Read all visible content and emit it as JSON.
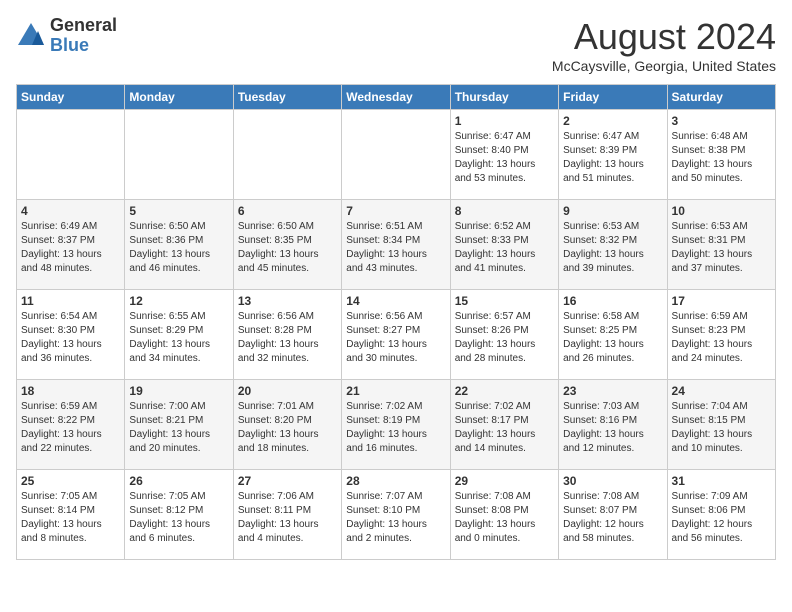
{
  "logo": {
    "general": "General",
    "blue": "Blue"
  },
  "title": "August 2024",
  "location": "McCaysville, Georgia, United States",
  "days_header": [
    "Sunday",
    "Monday",
    "Tuesday",
    "Wednesday",
    "Thursday",
    "Friday",
    "Saturday"
  ],
  "weeks": [
    [
      {
        "day": "",
        "info": ""
      },
      {
        "day": "",
        "info": ""
      },
      {
        "day": "",
        "info": ""
      },
      {
        "day": "",
        "info": ""
      },
      {
        "day": "1",
        "info": "Sunrise: 6:47 AM\nSunset: 8:40 PM\nDaylight: 13 hours\nand 53 minutes."
      },
      {
        "day": "2",
        "info": "Sunrise: 6:47 AM\nSunset: 8:39 PM\nDaylight: 13 hours\nand 51 minutes."
      },
      {
        "day": "3",
        "info": "Sunrise: 6:48 AM\nSunset: 8:38 PM\nDaylight: 13 hours\nand 50 minutes."
      }
    ],
    [
      {
        "day": "4",
        "info": "Sunrise: 6:49 AM\nSunset: 8:37 PM\nDaylight: 13 hours\nand 48 minutes."
      },
      {
        "day": "5",
        "info": "Sunrise: 6:50 AM\nSunset: 8:36 PM\nDaylight: 13 hours\nand 46 minutes."
      },
      {
        "day": "6",
        "info": "Sunrise: 6:50 AM\nSunset: 8:35 PM\nDaylight: 13 hours\nand 45 minutes."
      },
      {
        "day": "7",
        "info": "Sunrise: 6:51 AM\nSunset: 8:34 PM\nDaylight: 13 hours\nand 43 minutes."
      },
      {
        "day": "8",
        "info": "Sunrise: 6:52 AM\nSunset: 8:33 PM\nDaylight: 13 hours\nand 41 minutes."
      },
      {
        "day": "9",
        "info": "Sunrise: 6:53 AM\nSunset: 8:32 PM\nDaylight: 13 hours\nand 39 minutes."
      },
      {
        "day": "10",
        "info": "Sunrise: 6:53 AM\nSunset: 8:31 PM\nDaylight: 13 hours\nand 37 minutes."
      }
    ],
    [
      {
        "day": "11",
        "info": "Sunrise: 6:54 AM\nSunset: 8:30 PM\nDaylight: 13 hours\nand 36 minutes."
      },
      {
        "day": "12",
        "info": "Sunrise: 6:55 AM\nSunset: 8:29 PM\nDaylight: 13 hours\nand 34 minutes."
      },
      {
        "day": "13",
        "info": "Sunrise: 6:56 AM\nSunset: 8:28 PM\nDaylight: 13 hours\nand 32 minutes."
      },
      {
        "day": "14",
        "info": "Sunrise: 6:56 AM\nSunset: 8:27 PM\nDaylight: 13 hours\nand 30 minutes."
      },
      {
        "day": "15",
        "info": "Sunrise: 6:57 AM\nSunset: 8:26 PM\nDaylight: 13 hours\nand 28 minutes."
      },
      {
        "day": "16",
        "info": "Sunrise: 6:58 AM\nSunset: 8:25 PM\nDaylight: 13 hours\nand 26 minutes."
      },
      {
        "day": "17",
        "info": "Sunrise: 6:59 AM\nSunset: 8:23 PM\nDaylight: 13 hours\nand 24 minutes."
      }
    ],
    [
      {
        "day": "18",
        "info": "Sunrise: 6:59 AM\nSunset: 8:22 PM\nDaylight: 13 hours\nand 22 minutes."
      },
      {
        "day": "19",
        "info": "Sunrise: 7:00 AM\nSunset: 8:21 PM\nDaylight: 13 hours\nand 20 minutes."
      },
      {
        "day": "20",
        "info": "Sunrise: 7:01 AM\nSunset: 8:20 PM\nDaylight: 13 hours\nand 18 minutes."
      },
      {
        "day": "21",
        "info": "Sunrise: 7:02 AM\nSunset: 8:19 PM\nDaylight: 13 hours\nand 16 minutes."
      },
      {
        "day": "22",
        "info": "Sunrise: 7:02 AM\nSunset: 8:17 PM\nDaylight: 13 hours\nand 14 minutes."
      },
      {
        "day": "23",
        "info": "Sunrise: 7:03 AM\nSunset: 8:16 PM\nDaylight: 13 hours\nand 12 minutes."
      },
      {
        "day": "24",
        "info": "Sunrise: 7:04 AM\nSunset: 8:15 PM\nDaylight: 13 hours\nand 10 minutes."
      }
    ],
    [
      {
        "day": "25",
        "info": "Sunrise: 7:05 AM\nSunset: 8:14 PM\nDaylight: 13 hours\nand 8 minutes."
      },
      {
        "day": "26",
        "info": "Sunrise: 7:05 AM\nSunset: 8:12 PM\nDaylight: 13 hours\nand 6 minutes."
      },
      {
        "day": "27",
        "info": "Sunrise: 7:06 AM\nSunset: 8:11 PM\nDaylight: 13 hours\nand 4 minutes."
      },
      {
        "day": "28",
        "info": "Sunrise: 7:07 AM\nSunset: 8:10 PM\nDaylight: 13 hours\nand 2 minutes."
      },
      {
        "day": "29",
        "info": "Sunrise: 7:08 AM\nSunset: 8:08 PM\nDaylight: 13 hours\nand 0 minutes."
      },
      {
        "day": "30",
        "info": "Sunrise: 7:08 AM\nSunset: 8:07 PM\nDaylight: 12 hours\nand 58 minutes."
      },
      {
        "day": "31",
        "info": "Sunrise: 7:09 AM\nSunset: 8:06 PM\nDaylight: 12 hours\nand 56 minutes."
      }
    ]
  ]
}
